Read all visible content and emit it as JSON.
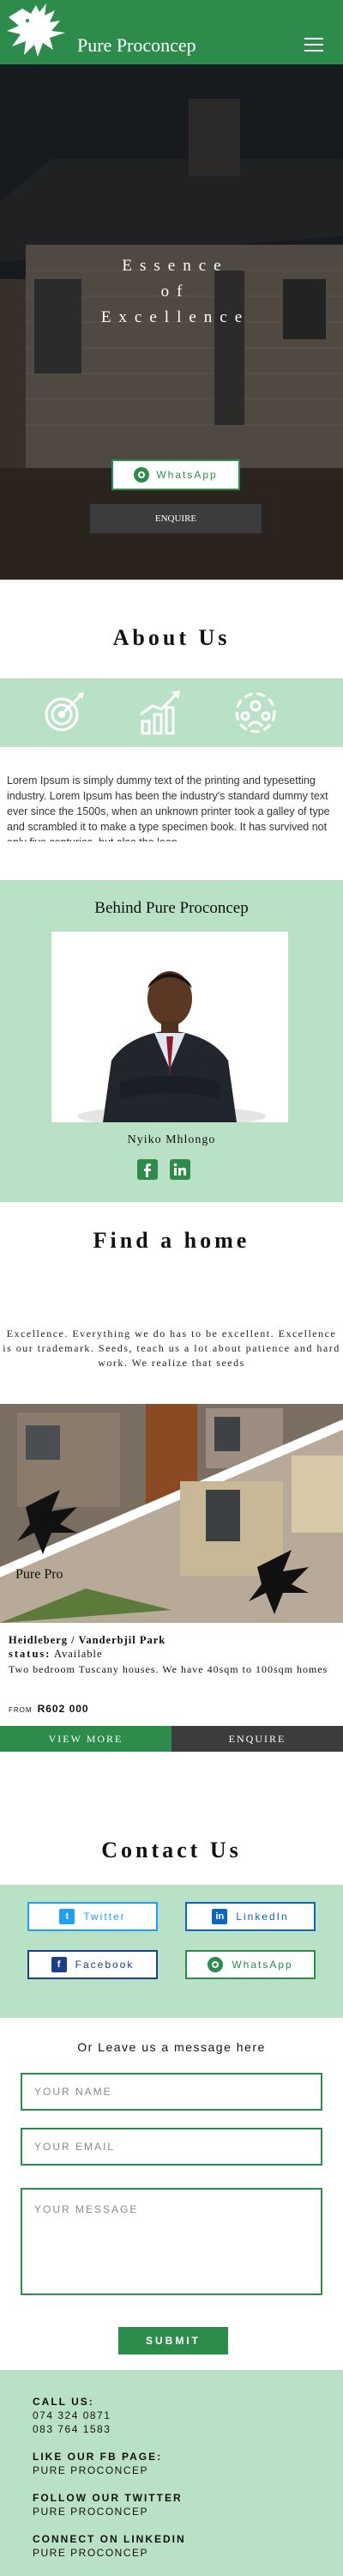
{
  "header": {
    "brand": "Pure Proconcep"
  },
  "hero": {
    "title_lines": [
      "Essence",
      "of",
      "Excellence"
    ],
    "whatsapp_label": "WhatsApp",
    "enquire_label": "ENQUIRE"
  },
  "about": {
    "title": "About Us",
    "text": "Lorem Ipsum is simply dummy text of the printing and typesetting industry. Lorem Ipsum has been the industry's standard dummy text ever since the 1500s, when an unknown printer took a galley of type and scrambled it to make a type specimen book. It has survived not only five centuries, but also the leap",
    "icons": [
      "target-icon",
      "growth-chart-icon",
      "team-icon"
    ]
  },
  "behind": {
    "title": "Behind Pure Proconcep",
    "person_name": "Nyiko Mhlongo"
  },
  "find": {
    "title": "Find a home",
    "text": "Excellence. Everything we do has to be excellent. Excellence is our trademark. Seeds, teach us a lot about patience and hard work. We realize that seeds"
  },
  "listing": {
    "title": "Heidleberg / Vanderbjil Park",
    "status_label": "status:",
    "status_value": "Available",
    "description": "Two bedroom Tuscany houses. We have 40sqm to 100sqm homes",
    "price_prefix": "FROM",
    "price": "R602 000",
    "view_more_label": "VIEW MORE",
    "enquire_label": "ENQUIRE",
    "watermark": "Pure Pro"
  },
  "contact": {
    "title": "Contact Us",
    "buttons": [
      {
        "label": "Twitter",
        "icon": "twitter-icon",
        "color": "#1da1f2"
      },
      {
        "label": "LinkedIn",
        "icon": "linkedin-icon",
        "color": "#0a66c2"
      },
      {
        "label": "Facebook",
        "icon": "facebook-icon",
        "color": "#1b3f8c"
      },
      {
        "label": "WhatsApp",
        "icon": "whatsapp-icon",
        "color": "#2d8c4b"
      }
    ]
  },
  "form": {
    "heading": "Or Leave us a message here",
    "name_placeholder": "YOUR NAME",
    "email_placeholder": "YOUR EMAIL",
    "message_placeholder": "YOUR MESSAGE",
    "submit_label": "SUBMIT"
  },
  "footer": {
    "call_heading": "CALL US:",
    "phones": [
      "074 324 0871",
      "083 764 1583"
    ],
    "fb_heading": "LIKE OUR FB PAGE:",
    "fb_value": "PURE PROCONCEP",
    "twitter_heading": "FOLLOW OUR TWITTER",
    "twitter_value": "PURE PROCONCEP",
    "linkedin_heading": "CONNECT ON LINKEDIN",
    "linkedin_value": "PURE PROCONCEP"
  },
  "colors": {
    "brand_green": "#2d8c4b",
    "light_green": "#b9e1c5",
    "dark_button": "#3c3c3e"
  }
}
